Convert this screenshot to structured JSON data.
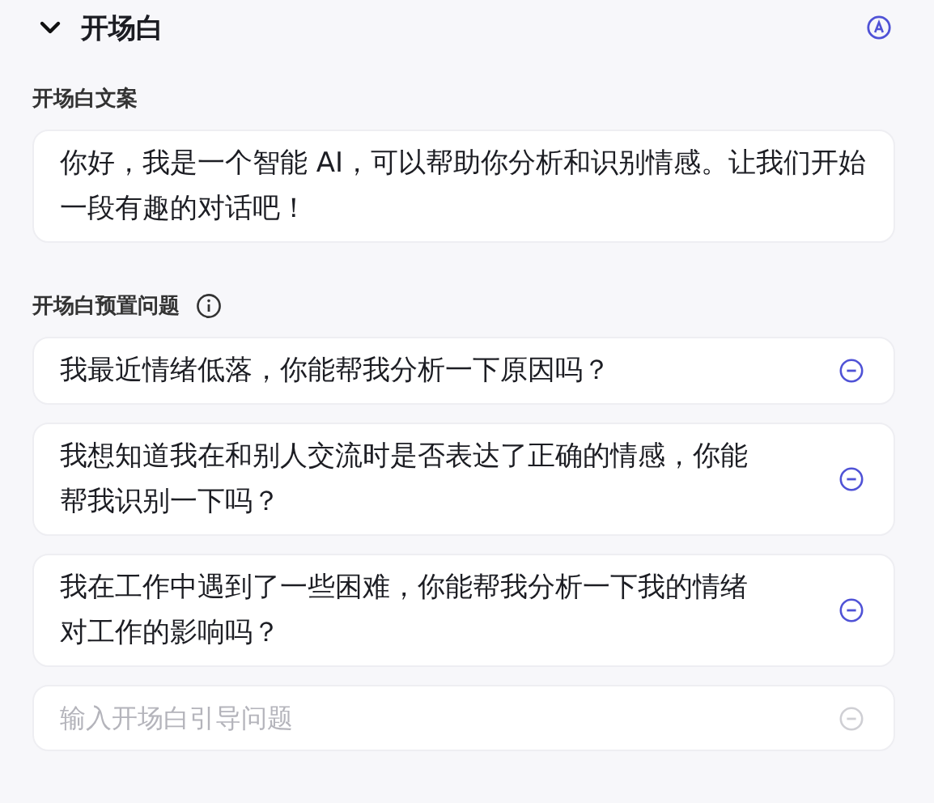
{
  "section": {
    "title": "开场白",
    "expanded": true
  },
  "opening_text": {
    "label": "开场白文案",
    "value": "你好，我是一个智能 AI，可以帮助你分析和识别情感。让我们开始一段有趣的对话吧！"
  },
  "preset_questions": {
    "label": "开场白预置问题",
    "items": [
      {
        "text": "我最近情绪低落，你能帮我分析一下原因吗？"
      },
      {
        "text": "我想知道我在和别人交流时是否表达了正确的情感，你能帮我识别一下吗？"
      },
      {
        "text": "我在工作中遇到了一些困难，你能帮我分析一下我的情绪对工作的影响吗？"
      }
    ],
    "new_question": {
      "placeholder": "输入开场白引导问题"
    }
  }
}
